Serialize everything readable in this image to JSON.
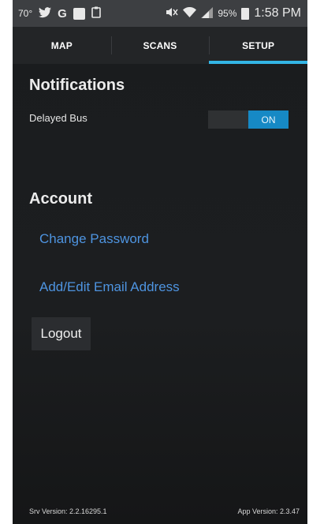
{
  "status_bar": {
    "temperature": "70°",
    "battery_percent": "95%",
    "time": "1:58 PM",
    "icons": [
      "twitter-icon",
      "google-icon",
      "flipboard-icon",
      "clipboard-icon",
      "mute-icon",
      "wifi-icon",
      "signal-icon",
      "battery-icon"
    ]
  },
  "tabs": [
    {
      "label": "MAP"
    },
    {
      "label": "SCANS"
    },
    {
      "label": "SETUP",
      "active": true
    }
  ],
  "notifications": {
    "title": "Notifications",
    "delayed_bus_label": "Delayed Bus",
    "toggle_state": "ON"
  },
  "account": {
    "title": "Account",
    "change_password": "Change Password",
    "edit_email": "Add/Edit Email Address",
    "logout": "Logout"
  },
  "footer": {
    "server_version": "Srv Version: 2.2.16295.1",
    "app_version": "App Version: 2.3.47"
  },
  "colors": {
    "accent": "#33b5e5",
    "toggle_on": "#1689c5",
    "link": "#4e94e0",
    "background": "#1c1e20"
  }
}
